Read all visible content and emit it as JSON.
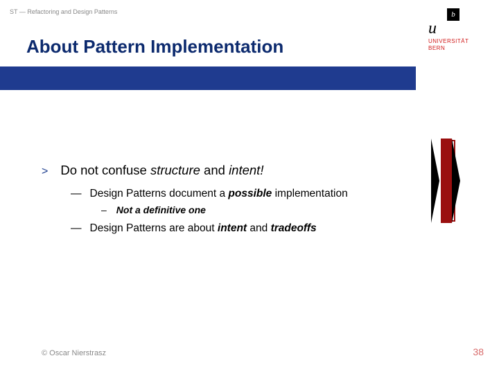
{
  "header": "ST — Refactoring and Design Patterns",
  "title": "About Pattern Implementation",
  "logo": {
    "u": "u",
    "b": "b",
    "uni1": "UNIVERSITÄT",
    "uni2": "BERN"
  },
  "content": {
    "main_arrow": ">",
    "main_pre": "Do not confuse ",
    "main_struct": "structure",
    "main_mid": " and ",
    "main_intent": "intent!",
    "sub1_dash": "—",
    "sub1_pre": "Design Patterns document a ",
    "sub1_emph": "possible",
    "sub1_post": " implementation",
    "subsub_dash": "–",
    "subsub_text": "Not a definitive one",
    "sub2_dash": "—",
    "sub2_pre": "Design Patterns are about ",
    "sub2_emph1": "intent",
    "sub2_mid": " and ",
    "sub2_emph2": "tradeoffs"
  },
  "footer": {
    "left": "© Oscar Nierstrasz",
    "right": "38"
  }
}
